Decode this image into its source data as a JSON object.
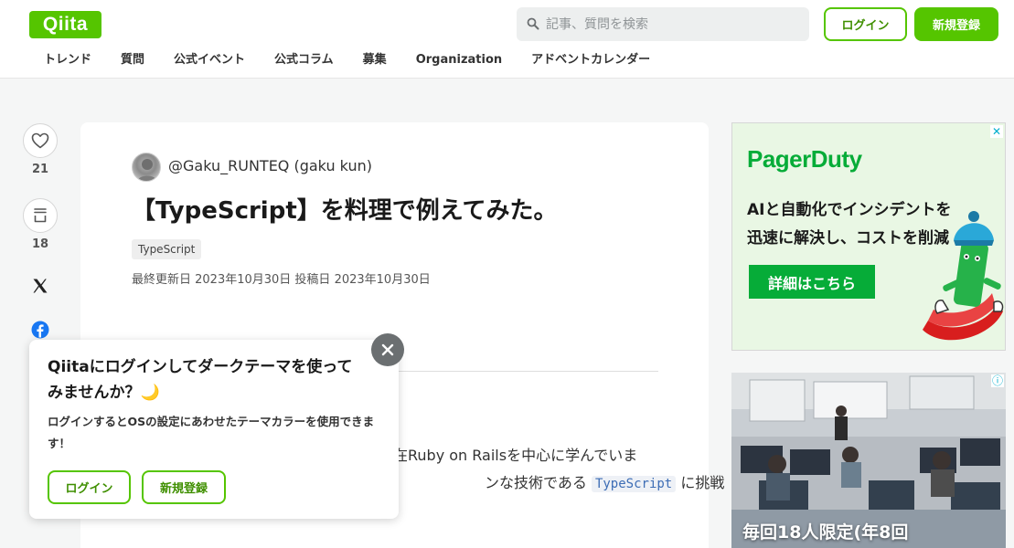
{
  "header": {
    "logo": "Qiita",
    "search_placeholder": "記事、質問を検索",
    "login_label": "ログイン",
    "signup_label": "新規登録",
    "nav": [
      "トレンド",
      "質問",
      "公式イベント",
      "公式コラム",
      "募集",
      "Organization",
      "アドベントカレンダー"
    ]
  },
  "actions": {
    "likes": "21",
    "stocks": "18",
    "share_icons": [
      "x-icon",
      "facebook-icon",
      "hatena-bookmark-icon",
      "more-icon"
    ]
  },
  "article": {
    "author": "@Gaku_RUNTEQ (gaku kun)",
    "title": "【TypeScript】を料理で例えてみた。",
    "tag": "TypeScript",
    "dates": "最終更新日 2023年10月30日  投稿日 2023年10月30日",
    "body_line1": "在Ruby on Railsを中心に学んでいま",
    "body_line2_pre": "ンな技術である",
    "body_code": "TypeScript",
    "body_line2_post": "に挑戦"
  },
  "popup": {
    "title": "Qiitaにログインしてダークテーマを使ってみませんか？🌙",
    "description": "ログインするとOSの設定にあわせたテーマカラーを使用できます！",
    "login_label": "ログイン",
    "signup_label": "新規登録"
  },
  "ads": {
    "ad1": {
      "brand": "PagerDuty",
      "line1": "AIと自動化でインシデントを",
      "line2": "迅速に解決し、コストを削減",
      "button": "詳細はこちら"
    },
    "ad2": {
      "caption": "毎回18人限定(年8回"
    }
  },
  "colors": {
    "brand": "#55c500",
    "pagerduty": "#06ac38"
  }
}
